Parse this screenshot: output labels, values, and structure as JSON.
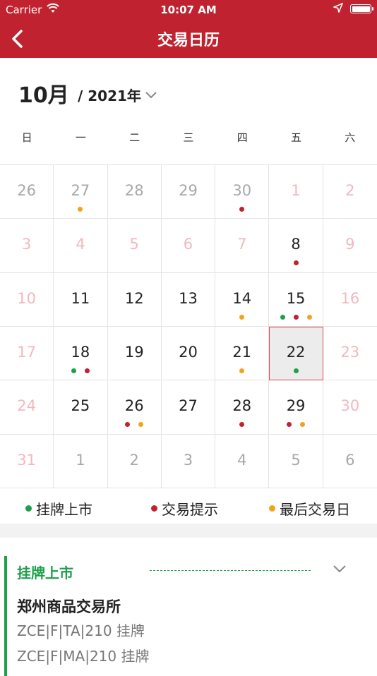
{
  "status": {
    "carrier": "Carrier",
    "time": "10:07 AM"
  },
  "nav": {
    "title": "交易日历"
  },
  "header": {
    "month": "10月",
    "year": "/ 2021年"
  },
  "weekdays": [
    "日",
    "一",
    "二",
    "三",
    "四",
    "五",
    "六"
  ],
  "colors": {
    "listing": "#1ea04b",
    "trade": "#c0232f",
    "last": "#f0a41c",
    "brand": "#c0232f"
  },
  "calendar": [
    {
      "day": "26",
      "style": "muted",
      "dots": []
    },
    {
      "day": "27",
      "style": "muted",
      "dots": [
        "last"
      ]
    },
    {
      "day": "28",
      "style": "muted",
      "dots": []
    },
    {
      "day": "29",
      "style": "muted",
      "dots": []
    },
    {
      "day": "30",
      "style": "muted",
      "dots": [
        "trade"
      ]
    },
    {
      "day": "1",
      "style": "weekend",
      "dots": []
    },
    {
      "day": "2",
      "style": "weekend",
      "dots": []
    },
    {
      "day": "3",
      "style": "weekend",
      "dots": []
    },
    {
      "day": "4",
      "style": "weekend",
      "dots": []
    },
    {
      "day": "5",
      "style": "weekend",
      "dots": []
    },
    {
      "day": "6",
      "style": "weekend",
      "dots": []
    },
    {
      "day": "7",
      "style": "weekend",
      "dots": []
    },
    {
      "day": "8",
      "style": "normal",
      "dots": [
        "trade"
      ]
    },
    {
      "day": "9",
      "style": "weekend",
      "dots": []
    },
    {
      "day": "10",
      "style": "weekend",
      "dots": []
    },
    {
      "day": "11",
      "style": "normal",
      "dots": []
    },
    {
      "day": "12",
      "style": "normal",
      "dots": []
    },
    {
      "day": "13",
      "style": "normal",
      "dots": []
    },
    {
      "day": "14",
      "style": "normal",
      "dots": [
        "last"
      ]
    },
    {
      "day": "15",
      "style": "normal",
      "dots": [
        "listing",
        "trade",
        "last"
      ]
    },
    {
      "day": "16",
      "style": "weekend",
      "dots": []
    },
    {
      "day": "17",
      "style": "weekend",
      "dots": []
    },
    {
      "day": "18",
      "style": "normal",
      "dots": [
        "listing",
        "trade"
      ]
    },
    {
      "day": "19",
      "style": "normal",
      "dots": []
    },
    {
      "day": "20",
      "style": "normal",
      "dots": []
    },
    {
      "day": "21",
      "style": "normal",
      "dots": [
        "last"
      ]
    },
    {
      "day": "22",
      "style": "normal",
      "selected": true,
      "dots": [
        "listing"
      ]
    },
    {
      "day": "23",
      "style": "weekend",
      "dots": []
    },
    {
      "day": "24",
      "style": "weekend",
      "dots": []
    },
    {
      "day": "25",
      "style": "normal",
      "dots": []
    },
    {
      "day": "26",
      "style": "normal",
      "dots": [
        "trade",
        "last"
      ]
    },
    {
      "day": "27",
      "style": "normal",
      "dots": []
    },
    {
      "day": "28",
      "style": "normal",
      "dots": [
        "trade"
      ]
    },
    {
      "day": "29",
      "style": "normal",
      "dots": [
        "trade",
        "last"
      ]
    },
    {
      "day": "30",
      "style": "weekend",
      "dots": []
    },
    {
      "day": "31",
      "style": "weekend",
      "dots": []
    },
    {
      "day": "1",
      "style": "muted",
      "dots": []
    },
    {
      "day": "2",
      "style": "muted",
      "dots": []
    },
    {
      "day": "3",
      "style": "muted",
      "dots": []
    },
    {
      "day": "4",
      "style": "muted",
      "dots": []
    },
    {
      "day": "5",
      "style": "muted",
      "dots": []
    },
    {
      "day": "6",
      "style": "muted",
      "dots": []
    }
  ],
  "legend": {
    "listing": "挂牌上市",
    "trade": "交易提示",
    "last": "最后交易日"
  },
  "panel": {
    "heading": "挂牌上市",
    "exchange": "郑州商品交易所",
    "items": [
      "ZCE|F|TA|210 挂牌",
      "ZCE|F|MA|210 挂牌"
    ]
  }
}
